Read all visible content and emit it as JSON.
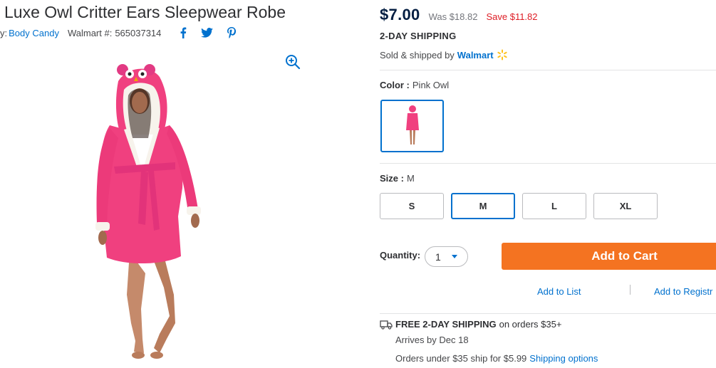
{
  "product": {
    "title": "Luxe Owl Critter Ears Sleepwear Robe",
    "by_label": "y:",
    "brand": "Body Candy",
    "walmart_number_label": "Walmart #:",
    "walmart_number": "565037314"
  },
  "social": {
    "facebook": "f",
    "twitter": "t",
    "pinterest": "p"
  },
  "pricing": {
    "price": "$7.00",
    "was": "Was $18.82",
    "save": "Save $11.82"
  },
  "shipping": {
    "two_day": "2-DAY SHIPPING",
    "sold_by_label": "Sold & shipped by",
    "seller": "Walmart"
  },
  "color": {
    "label": "Color :",
    "value": "Pink Owl"
  },
  "size": {
    "label": "Size :",
    "value": "M",
    "options": [
      "S",
      "M",
      "L",
      "XL"
    ],
    "selected": "M"
  },
  "quantity": {
    "label": "Quantity:",
    "value": "1"
  },
  "actions": {
    "add_to_cart": "Add to Cart",
    "add_to_list": "Add to List",
    "add_to_registry": "Add to Registr"
  },
  "delivery": {
    "free_shipping_bold": "FREE 2-DAY SHIPPING",
    "free_shipping_rest": "on orders $35+",
    "arrives": "Arrives by Dec 18",
    "orders_under": "Orders under $35 ship for $5.99",
    "shipping_options": "Shipping options"
  },
  "colors": {
    "accent": "#0071ce",
    "cta": "#f47321",
    "save_red": "#de1c24",
    "robe_pink": "#f0407f",
    "spark_yellow": "#ffc220"
  }
}
